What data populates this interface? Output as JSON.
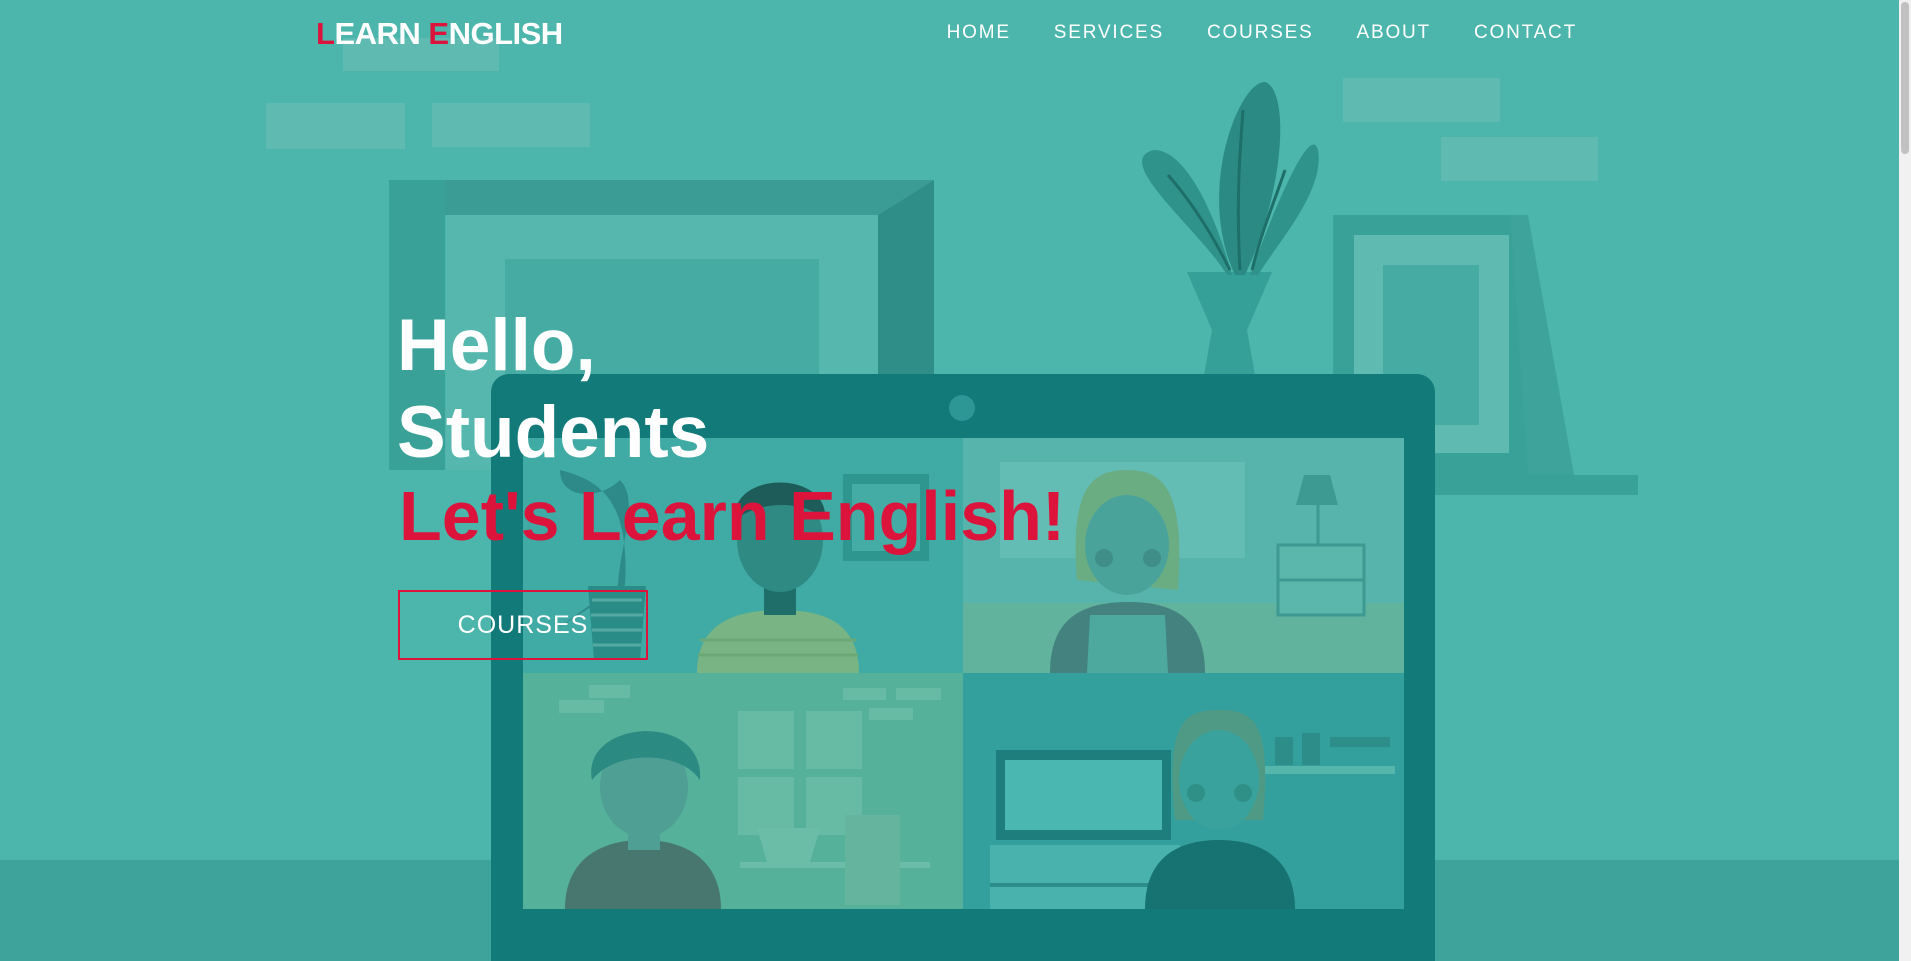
{
  "brand": {
    "first_initial": "L",
    "first_rest": "EARN ",
    "second_initial": "E",
    "second_rest": "NGLISH",
    "accent_color": "#dc143c"
  },
  "nav": {
    "items": [
      {
        "label": "HOME"
      },
      {
        "label": "SERVICES"
      },
      {
        "label": "COURSES"
      },
      {
        "label": "ABOUT"
      },
      {
        "label": "CONTACT"
      }
    ]
  },
  "hero": {
    "greeting_line1": "Hello,",
    "greeting_line2": "Students",
    "tagline": "Let's Learn English!",
    "button_label": "COURSES",
    "background_color": "#4db6ac"
  }
}
